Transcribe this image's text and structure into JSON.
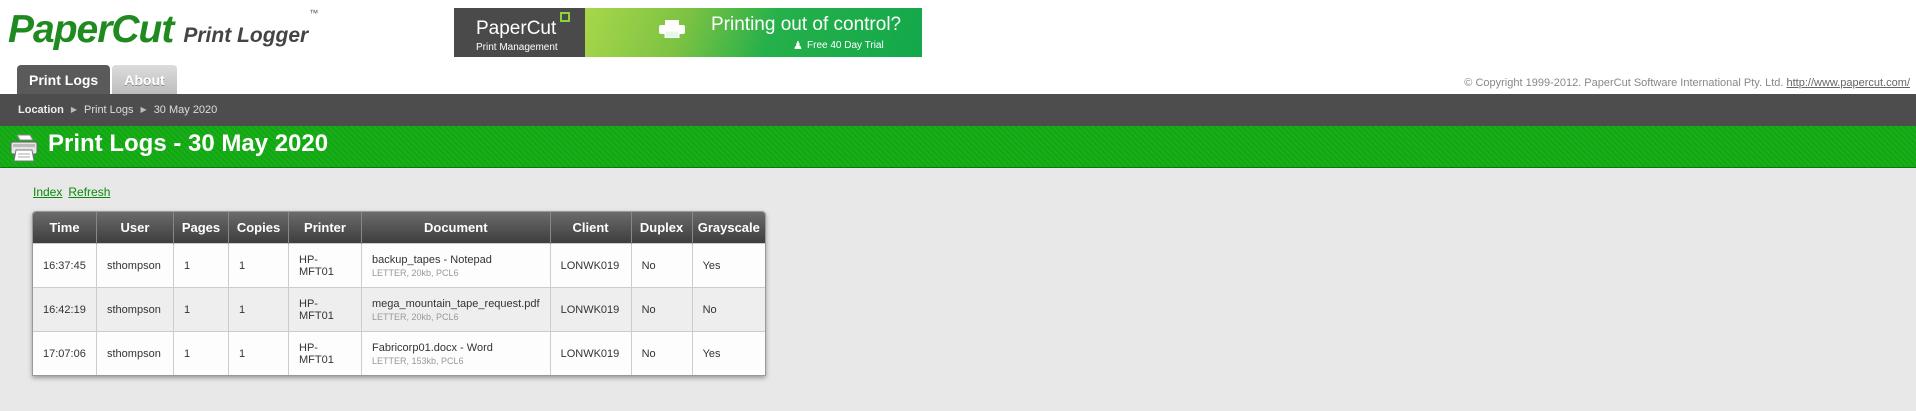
{
  "header": {
    "brand": "PaperCut",
    "product": "Print Logger",
    "trademark": "™",
    "copyright": "© Copyright 1999-2012. PaperCut Software International Pty. Ltd.",
    "copyright_link": "http://www.papercut.com/"
  },
  "banner": {
    "brand": "PaperCut",
    "subtitle": "Print Management",
    "headline": "Printing out of control?",
    "trial": "Free 40 Day Trial"
  },
  "tabs": [
    {
      "label": "Print Logs",
      "active": true
    },
    {
      "label": "About",
      "active": false
    }
  ],
  "breadcrumb": {
    "location_label": "Location",
    "items": [
      "Print Logs",
      "30 May 2020"
    ]
  },
  "page": {
    "title": "Print Logs - 30 May 2020"
  },
  "actions": {
    "index": "Index",
    "refresh": "Refresh"
  },
  "table": {
    "columns": [
      "Time",
      "User",
      "Pages",
      "Copies",
      "Printer",
      "Document",
      "Client",
      "Duplex",
      "Grayscale"
    ],
    "rows": [
      {
        "time": "16:37:45",
        "user": "sthompson",
        "pages": "1",
        "copies": "1",
        "printer": "HP-MFT01",
        "document": "backup_tapes - Notepad",
        "doc_meta": "LETTER, 20kb, PCL6",
        "client": "LONWK019",
        "duplex": "No",
        "grayscale": "Yes"
      },
      {
        "time": "16:42:19",
        "user": "sthompson",
        "pages": "1",
        "copies": "1",
        "printer": "HP-MFT01",
        "document": "mega_mountain_tape_request.pdf",
        "doc_meta": "LETTER, 20kb, PCL6",
        "client": "LONWK019",
        "duplex": "No",
        "grayscale": "No"
      },
      {
        "time": "17:07:06",
        "user": "sthompson",
        "pages": "1",
        "copies": "1",
        "printer": "HP-MFT01",
        "document": "Fabricorp01.docx - Word",
        "doc_meta": "LETTER, 153kb, PCL6",
        "client": "LONWK019",
        "duplex": "No",
        "grayscale": "Yes"
      }
    ]
  },
  "colors": {
    "brand_green": "#10a810",
    "header_dark": "#4d4d4d",
    "link_green": "#0a8a0a"
  }
}
